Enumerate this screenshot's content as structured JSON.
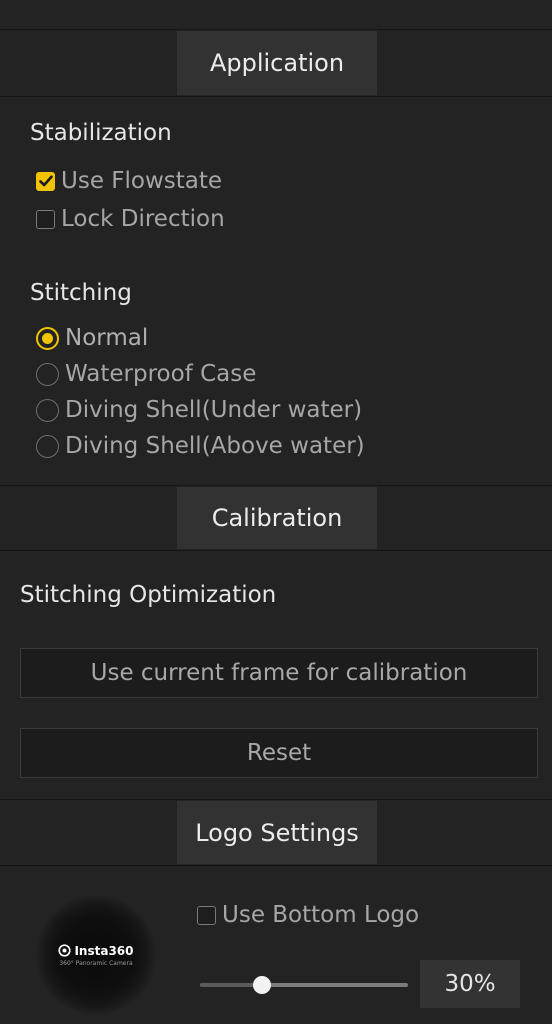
{
  "sections": {
    "application_tab": "Application",
    "calibration_tab": "Calibration",
    "logo_tab": "Logo Settings"
  },
  "stabilization": {
    "heading": "Stabilization",
    "use_flowstate": {
      "label": "Use Flowstate",
      "checked": true
    },
    "lock_direction": {
      "label": "Lock Direction",
      "checked": false
    }
  },
  "stitching": {
    "heading": "Stitching",
    "options": [
      {
        "label": "Normal",
        "selected": true
      },
      {
        "label": "Waterproof Case",
        "selected": false
      },
      {
        "label": "Diving Shell(Under water)",
        "selected": false
      },
      {
        "label": "Diving Shell(Above water)",
        "selected": false
      }
    ]
  },
  "calibration": {
    "heading": "Stitching Optimization",
    "use_frame_button": "Use current frame for calibration",
    "reset_button": "Reset"
  },
  "logo": {
    "brand": "Insta360",
    "tagline": "360° Panoramic Camera",
    "use_bottom_logo": {
      "label": "Use Bottom Logo",
      "checked": false
    },
    "size_percent": 30,
    "size_label": "30%"
  },
  "colors": {
    "accent": "#f2c300",
    "background": "#232323",
    "tab_background": "#323232"
  }
}
